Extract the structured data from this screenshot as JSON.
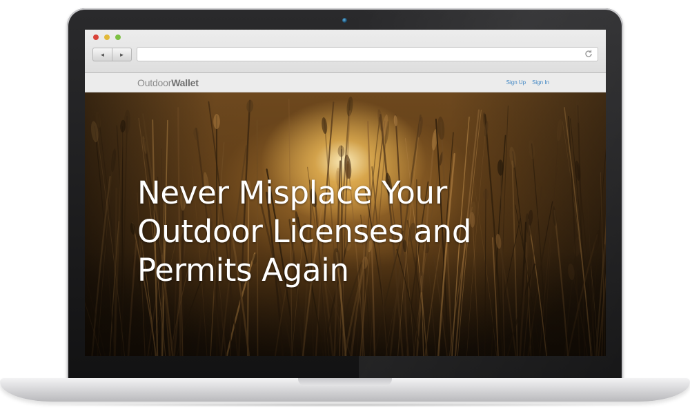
{
  "browser": {
    "back_glyph": "◄",
    "forward_glyph": "►",
    "url": ""
  },
  "site": {
    "logo_light": "Outdoor",
    "logo_bold": "Wallet",
    "nav": {
      "sign_up": "Sign Up",
      "sign_in": "Sign In"
    }
  },
  "hero": {
    "title": "Never Misplace Your Outdoor Licenses and Permits Again"
  },
  "colors": {
    "link": "#3f86c4",
    "logo": "#8a8a8a",
    "hero_text": "#ffffff"
  },
  "icons": [
    "traffic-light-close-icon",
    "traffic-light-minimize-icon",
    "traffic-light-zoom-icon",
    "back-arrow-icon",
    "forward-arrow-icon",
    "reload-icon",
    "webcam-icon"
  ]
}
